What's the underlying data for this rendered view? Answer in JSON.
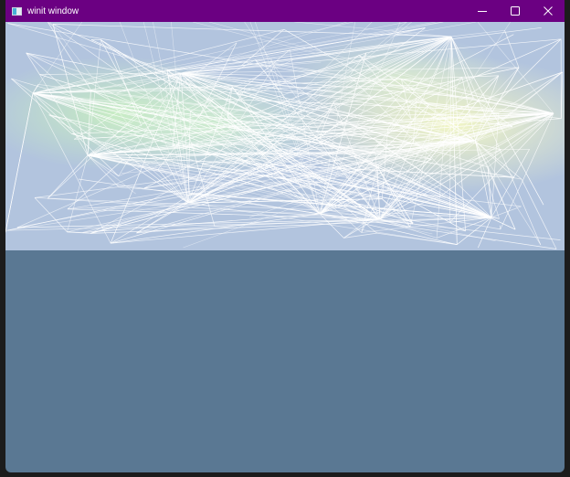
{
  "window": {
    "title": "winit window",
    "titlebar_color": "#6b0082",
    "background_color": "#5a7893",
    "controls": [
      {
        "name": "minimize-button",
        "icon": "minimize-icon"
      },
      {
        "name": "maximize-button",
        "icon": "maximize-icon"
      },
      {
        "name": "close-button",
        "icon": "close-icon"
      }
    ]
  },
  "render": {
    "line_color": "#ffffff",
    "base_color": "#b2c4de",
    "glow_colors": [
      "#c9f0c0",
      "#f2f6c6",
      "#d4f3cf"
    ]
  }
}
